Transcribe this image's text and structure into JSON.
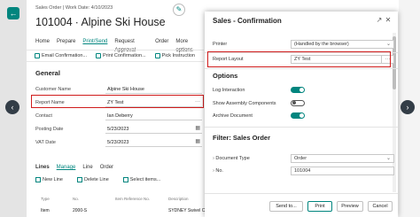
{
  "page": {
    "breadcrumb": "Sales Order | Work Date: 4/10/2023",
    "title": "101004 ∙ Alpine Ski House",
    "action_tabs": [
      "Home",
      "Prepare",
      "Print/Send",
      "Request Approval",
      "Order",
      "More options"
    ],
    "actions": [
      "Email Confirmation...",
      "Print Confirmation...",
      "Pick Instruction"
    ],
    "general_heading": "General",
    "fields": [
      {
        "label": "Customer Name",
        "value": "Alpine Ski House"
      },
      {
        "label": "Report Name",
        "value": "ZY Test"
      },
      {
        "label": "Contact",
        "value": "Ian Deberry"
      },
      {
        "label": "Posting Date",
        "value": "5/23/2023"
      },
      {
        "label": "VAT Date",
        "value": "5/23/2023"
      }
    ],
    "lines_tabs": [
      "Lines",
      "Manage",
      "Line",
      "Order"
    ],
    "lines_actions": [
      "New Line",
      "Delete Line",
      "Select items..."
    ],
    "lines_header": [
      "Type",
      "No.",
      "Item Reference No.",
      "Description"
    ],
    "lines_row": [
      "Item",
      "2000-S",
      "",
      "SYDNEY Swivel Chair, green"
    ]
  },
  "dialog": {
    "title": "Sales - Confirmation",
    "printer_label": "Printer",
    "printer_value": "(Handled by the browser)",
    "report_layout_label": "Report Layout",
    "report_layout_value": "ZY Test",
    "options_heading": "Options",
    "options": [
      {
        "label": "Log Interaction",
        "on": true
      },
      {
        "label": "Show Assembly Components",
        "on": false
      },
      {
        "label": "Archive Document",
        "on": true
      }
    ],
    "filter_heading": "Filter: Sales Order",
    "filters": [
      {
        "label": "Document Type",
        "value": "Order"
      },
      {
        "label": "No.",
        "value": "101004"
      }
    ],
    "buttons": {
      "send_to": "Send to...",
      "print": "Print",
      "preview": "Preview",
      "cancel": "Cancel"
    }
  },
  "colors": {
    "accent": "#00857e",
    "highlight": "#d01c1c"
  }
}
